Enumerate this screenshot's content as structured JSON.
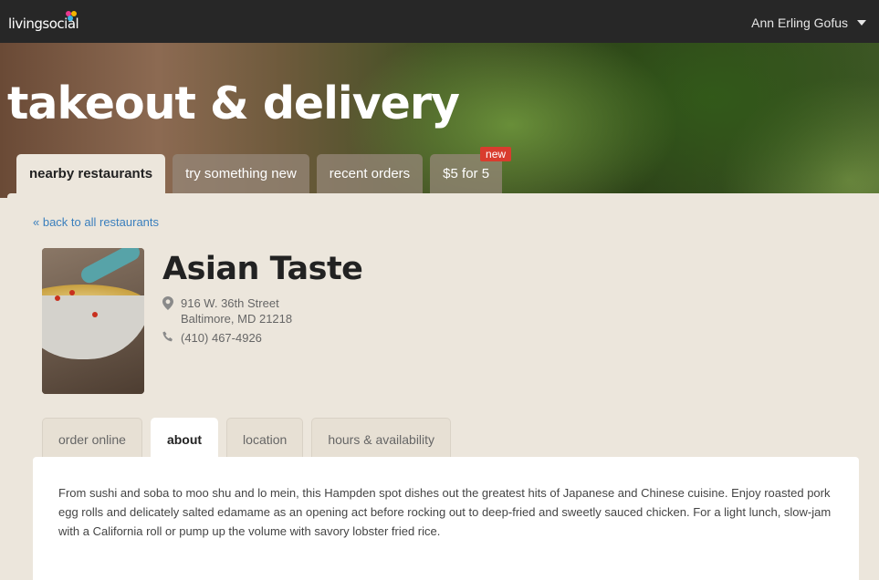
{
  "header": {
    "logo_text": "livingsocial",
    "user_name": "Ann Erling Gofus"
  },
  "hero": {
    "title": "takeout & delivery"
  },
  "main_tabs": [
    {
      "label": "nearby restaurants",
      "active": true
    },
    {
      "label": "try something new",
      "active": false
    },
    {
      "label": "recent orders",
      "active": false
    },
    {
      "label": "$5 for 5",
      "active": false,
      "badge": "new"
    }
  ],
  "back_link": "« back to all restaurants",
  "restaurant": {
    "name": "Asian Taste",
    "address_line1": "916 W. 36th Street",
    "address_line2": "Baltimore, MD 21218",
    "phone": "(410) 467-4926"
  },
  "sub_tabs": [
    {
      "label": "order online",
      "active": false
    },
    {
      "label": "about",
      "active": true
    },
    {
      "label": "location",
      "active": false
    },
    {
      "label": "hours & availability",
      "active": false
    }
  ],
  "about": {
    "text": "From sushi and soba to moo shu and lo mein, this Hampden spot dishes out the greatest hits of Japanese and Chinese cuisine. Enjoy roasted pork egg rolls and delicately salted edamame as an opening act before rocking out to deep-fried and sweetly sauced chicken. For a light lunch, slow-jam with a California roll or pump up the volume with savory lobster fried rice."
  },
  "icons": {
    "location": "map-pin-icon",
    "phone": "phone-icon",
    "user_caret": "caret-down-icon"
  },
  "colors": {
    "topbar": "#272727",
    "link": "#3a7fbd",
    "badge": "#d93c2e",
    "panel": "#ece6dc"
  }
}
